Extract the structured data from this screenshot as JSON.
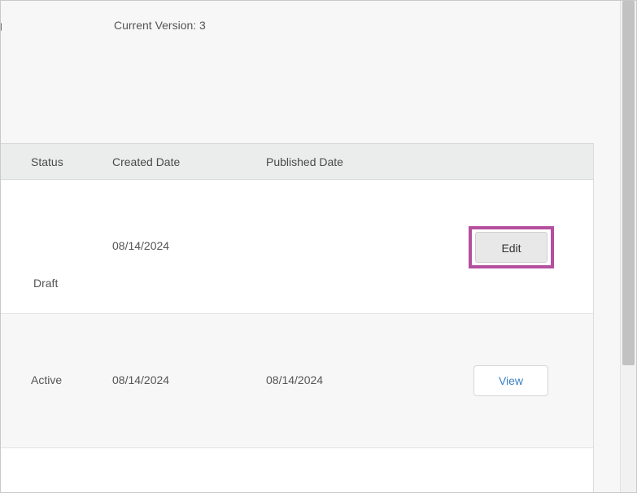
{
  "details": {
    "clipped_label": "g",
    "current_version": "Current Version: 3"
  },
  "table": {
    "headers": {
      "status": "Status",
      "created_date": "Created Date",
      "published_date": "Published Date"
    },
    "rows": [
      {
        "status": "Draft",
        "created_date": "08/14/2024",
        "published_date": "",
        "action": "Edit"
      },
      {
        "status": "Active",
        "created_date": "08/14/2024",
        "published_date": "08/14/2024",
        "action": "View"
      }
    ]
  },
  "colors": {
    "highlight": "#b5509f",
    "link": "#3b7fc4",
    "header_bg": "#ebedec"
  }
}
